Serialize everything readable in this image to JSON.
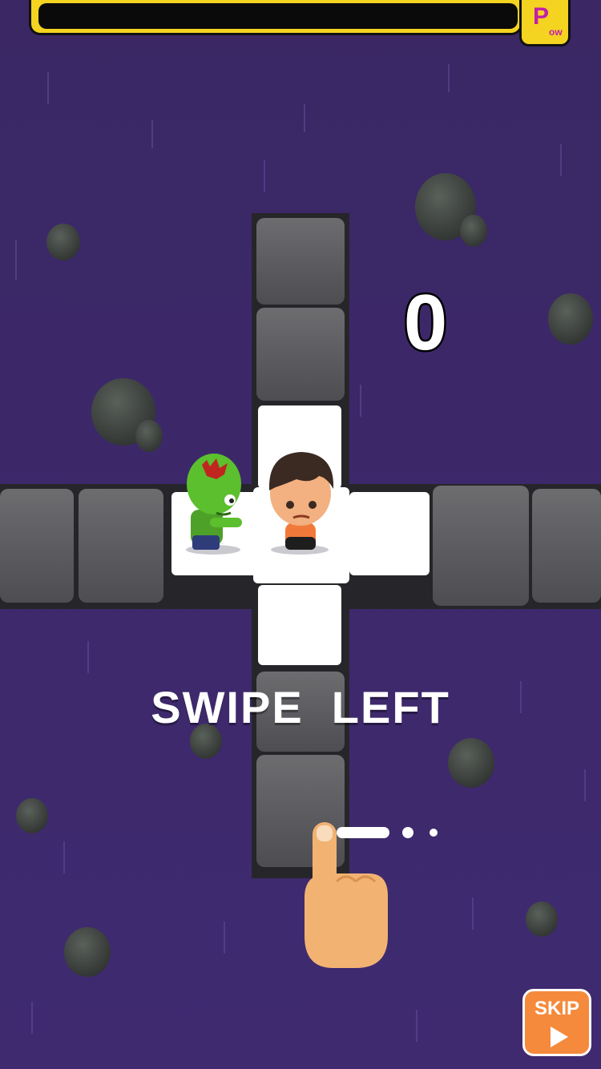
{
  "hud": {
    "pow_label_big": "P",
    "pow_label_small": "ow",
    "pow_fill_fraction": 0.0
  },
  "score": {
    "value": "0"
  },
  "tutorial": {
    "instruction": "SWIPE  LEFT",
    "page_indicator": {
      "active": 1,
      "total": 3
    }
  },
  "skip_button": {
    "label": "SKIP",
    "icon": "play-triangle-icon"
  },
  "icons": {
    "hand": "pointing-hand-icon",
    "player": "boy-hero-sprite",
    "enemy": "green-zombie-sprite",
    "rocks": "boulder-icon"
  },
  "colors": {
    "background": "#3e2a6b",
    "path_stone": "#5a5a5e",
    "highlight_tile": "#ffffff",
    "pow_bar": "#f4d321",
    "pow_letter": "#c21fa8",
    "skip_button": "#f58a3c",
    "zombie": "#5bbf2e",
    "hand": "#f2b272"
  }
}
